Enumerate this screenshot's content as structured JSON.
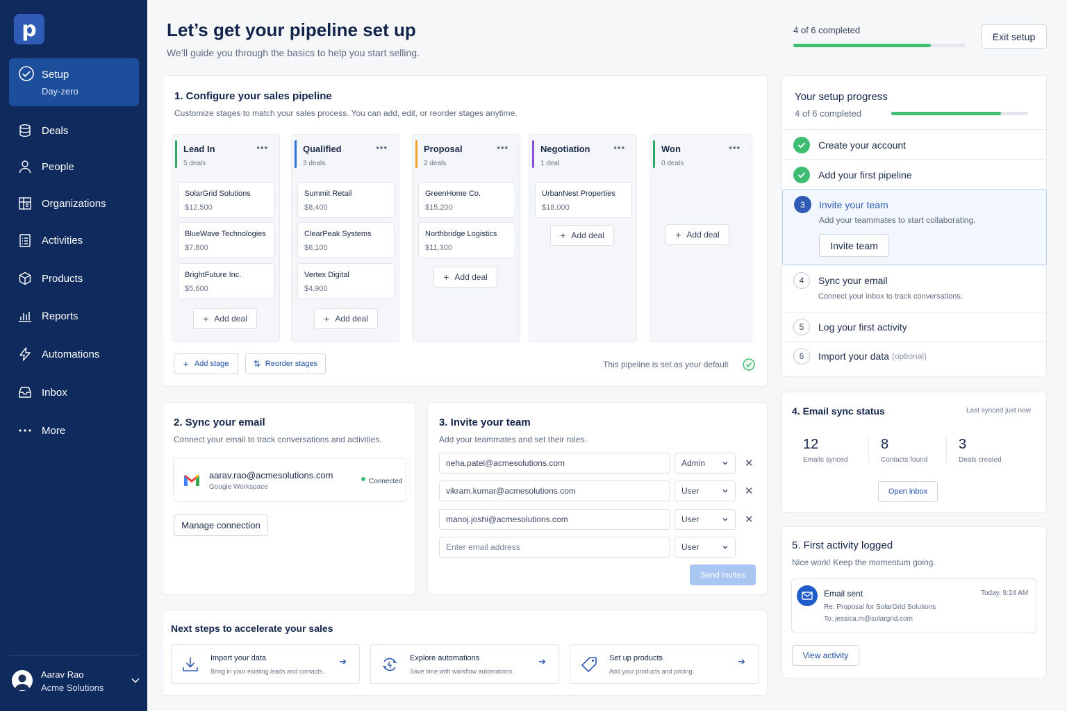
{
  "sidebar": {
    "logo": "p",
    "active": {
      "label": "Setup",
      "sub": "Day-zero"
    },
    "items": [
      {
        "label": "Deals",
        "icon": "database-icon"
      },
      {
        "label": "People",
        "icon": "person-icon"
      },
      {
        "label": "Organizations",
        "icon": "building-icon"
      },
      {
        "label": "Activities",
        "icon": "checklist-icon"
      },
      {
        "label": "Products",
        "icon": "box-icon"
      },
      {
        "label": "Reports",
        "icon": "bar-chart-icon"
      },
      {
        "label": "Automations",
        "icon": "lightning-icon"
      },
      {
        "label": "Inbox",
        "icon": "inbox-icon"
      },
      {
        "label": "More",
        "icon": "dots-icon"
      }
    ],
    "user": {
      "name": "Aarav Rao",
      "org": "Acme Solutions"
    }
  },
  "header": {
    "title": "Let’s get your pipeline set up",
    "subtitle": "We’ll guide you through the basics to help you start selling.",
    "progress_text": "4 of 6 completed",
    "progress": 0.8,
    "exit_label": "Exit setup"
  },
  "pipeline": {
    "title": "1. Configure your sales pipeline",
    "subtitle": "Customize stages to match your sales process. You can add, edit, or reorder stages anytime.",
    "stages": [
      {
        "name": "Lead In",
        "count": "5 deals",
        "color": "#2fa866",
        "deals": [
          {
            "name": "SolarGrid Solutions",
            "value": "$12,500"
          },
          {
            "name": "BlueWave Technologies",
            "value": "$7,800"
          },
          {
            "name": "BrightFuture Inc.",
            "value": "$5,600"
          }
        ]
      },
      {
        "name": "Qualified",
        "count": "3 deals",
        "color": "#2f6fd6",
        "deals": [
          {
            "name": "Summit Retail",
            "value": "$8,400"
          },
          {
            "name": "ClearPeak Systems",
            "value": "$6,100"
          },
          {
            "name": "Vertex Digital",
            "value": "$4,900"
          }
        ]
      },
      {
        "name": "Proposal",
        "count": "2 deals",
        "color": "#f0a522",
        "deals": [
          {
            "name": "GreenHome Co.",
            "value": "$15,200"
          },
          {
            "name": "Northbridge Logistics",
            "value": "$11,300"
          }
        ]
      },
      {
        "name": "Negotiation",
        "count": "1 deal",
        "color": "#8a4fd8",
        "deals": [
          {
            "name": "UrbanNest Properties",
            "value": "$18,000"
          }
        ]
      },
      {
        "name": "Won",
        "count": "0 deals",
        "color": "#2fa866",
        "deals": []
      }
    ],
    "add_deal_label": "Add deal",
    "add_stage_label": "Add stage",
    "reorder_label": "Reorder stages",
    "default_note": "This pipeline is set as your default"
  },
  "sync_email": {
    "title": "2. Sync your email",
    "subtitle": "Connect your email to track conversations and activities.",
    "account": "aarav.rao@acmesolutions.com",
    "provider": "Google Workspace",
    "status": "Connected",
    "manage_label": "Manage connection"
  },
  "invite": {
    "title": "3. Invite your team",
    "subtitle": "Add your teammates and set their roles.",
    "rows": [
      {
        "email": "neha.patel@acmesolutions.com",
        "role": "Admin"
      },
      {
        "email": "vikram.kumar@acmesolutions.com",
        "role": "User"
      },
      {
        "email": "manoj.joshi@acmesolutions.com",
        "role": "User"
      }
    ],
    "placeholder": "Enter email address",
    "default_role": "User",
    "send_label": "Send invites"
  },
  "next_steps": {
    "title": "Next steps to accelerate your sales",
    "items": [
      {
        "title": "Import your data",
        "desc": "Bring in your existing leads and contacts.",
        "icon": "download-icon"
      },
      {
        "title": "Explore automations",
        "desc": "Save time with workflow automations.",
        "icon": "automation-icon"
      },
      {
        "title": "Set up products",
        "desc": "Add your products and pricing.",
        "icon": "tag-icon"
      }
    ]
  },
  "progress_panel": {
    "title": "Your setup progress",
    "completed": "4 of 6 completed",
    "progress": 0.8,
    "steps": [
      {
        "num": "1",
        "title": "Create your account",
        "done": true
      },
      {
        "num": "2",
        "title": "Add your first pipeline",
        "done": true
      },
      {
        "num": "3",
        "title": "Invite your team",
        "desc": "Add your teammates to start collaborating.",
        "button": "Invite team",
        "active": true
      },
      {
        "num": "4",
        "title": "Sync your email",
        "desc": "Connect your inbox to track conversations."
      },
      {
        "num": "5",
        "title": "Log your first activity"
      },
      {
        "num": "6",
        "title": "Import your data",
        "optional": "(optional)"
      }
    ]
  },
  "email_sync": {
    "title": "4. Email sync status",
    "last_synced": "Last synced just now",
    "stats": [
      {
        "value": "12",
        "label": "Emails synced"
      },
      {
        "value": "8",
        "label": "Contacts found"
      },
      {
        "value": "3",
        "label": "Deals created"
      }
    ],
    "button": "Open inbox"
  },
  "first_activity": {
    "title": "5. First activity logged",
    "subtitle": "Nice work! Keep the momentum going.",
    "activity_title": "Email sent",
    "time": "Today, 9:24 AM",
    "re": "Re: Proposal for SolarGrid Solutions",
    "to": "To: jessica.m@solargrid.com",
    "button": "View activity"
  },
  "colors": {
    "sidebar": "#0f2a5c",
    "accent": "#2f5bb6",
    "success": "#3ebd73"
  }
}
